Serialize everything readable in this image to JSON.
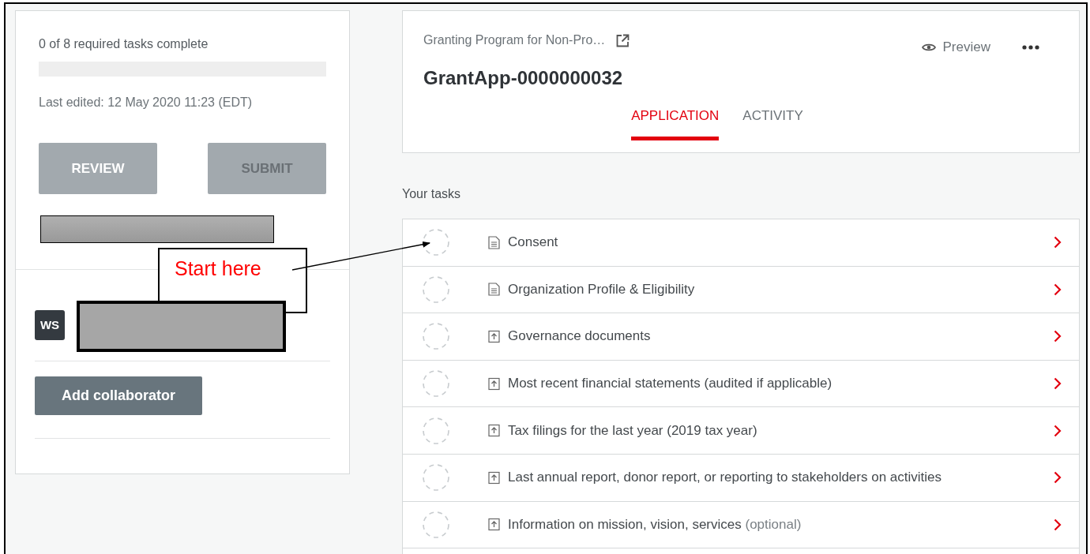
{
  "progress": {
    "summary": "0 of 8 required tasks complete",
    "level": 0
  },
  "last_edited": "Last edited: 12 May 2020 11:23 (EDT)",
  "actions": [
    {
      "label": "REVIEW",
      "disabled": false
    },
    {
      "label": "SUBMIT",
      "disabled": true
    }
  ],
  "collaborator": {
    "initials": "WS"
  },
  "add_collaborator": "Add collaborator",
  "program": "Granting Program for Non-Pro…",
  "title": "GrantApp-0000000032",
  "preview": "Preview",
  "tabs": [
    {
      "label": "APPLICATION",
      "selected": true
    },
    {
      "label": "ACTIVITY",
      "selected": false
    }
  ],
  "tasks_heading": "Your tasks",
  "tasks": [
    {
      "kind": "form",
      "label": "Consent",
      "complete": false
    },
    {
      "kind": "form",
      "label": "Organization Profile & Eligibility",
      "complete": false
    },
    {
      "kind": "upload",
      "label": "Governance documents",
      "complete": false
    },
    {
      "kind": "upload",
      "label": "Most recent financial statements (audited if applicable)",
      "complete": false
    },
    {
      "kind": "upload",
      "label": "Tax filings for the last year (2019 tax year)",
      "complete": false
    },
    {
      "kind": "upload",
      "label": "Last annual report, donor report, or reporting to stakeholders on activities",
      "complete": false
    },
    {
      "kind": "upload",
      "label": "Information on mission, vision, services",
      "note": "(optional)",
      "complete": false
    }
  ],
  "annotation": {
    "text": "Start here"
  }
}
